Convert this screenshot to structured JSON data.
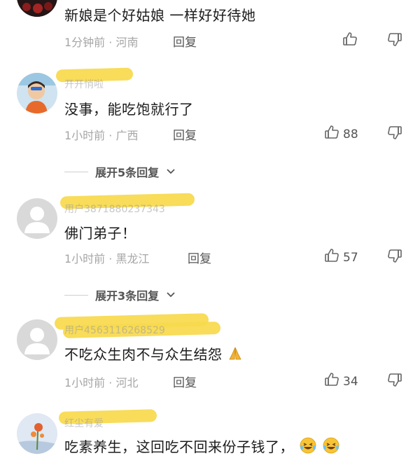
{
  "comments": [
    {
      "text": "新娘是个好姑娘  一样好好待她",
      "time": "1分钟前",
      "location": "河南",
      "reply_label": "回复",
      "likes": ""
    },
    {
      "username": "开开悄啦",
      "text": "没事，能吃饱就行了",
      "time": "1小时前",
      "location": "广西",
      "reply_label": "回复",
      "likes": "88",
      "expand_label": "展开5条回复"
    },
    {
      "username": "用户3871880237343",
      "text": "佛门弟子！",
      "time": "1小时前",
      "location": "黑龙江",
      "reply_label": "回复",
      "likes": "57",
      "expand_label": "展开3条回复"
    },
    {
      "username": "用户4563116268529",
      "text": "不吃众生肉不与众生结怨",
      "time": "1小时前",
      "location": "河北",
      "reply_label": "回复",
      "likes": "34"
    },
    {
      "username": "红尘有爱",
      "text": "吃素养生，这回吃不回来份子钱了，"
    }
  ],
  "separator": " · ",
  "colors": {
    "highlight": "#f7d94c",
    "meta": "#a6a6a6",
    "text": "#1b1b1b"
  }
}
